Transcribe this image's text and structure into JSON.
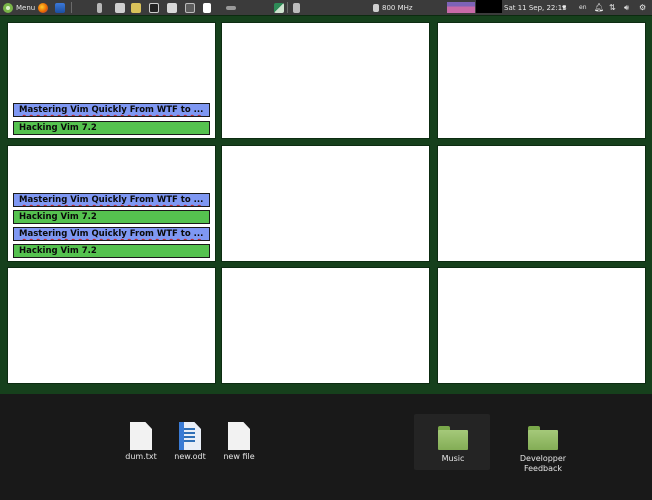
{
  "panel": {
    "menu_label": "Menu",
    "cpu_freq": "800 MHz",
    "datetime": "Sat 11 Sep, 22:13",
    "keyboard_layout": "en"
  },
  "workspaces": [
    {
      "windows": [
        {
          "title": "Mastering Vim Quickly From WTF to ...",
          "kind": "vim"
        },
        {
          "title": "Hacking Vim 7.2",
          "kind": "hack"
        }
      ]
    },
    {
      "windows": []
    },
    {
      "windows": []
    },
    {
      "windows": [
        {
          "title": "Mastering Vim Quickly From WTF to ...",
          "kind": "vim"
        },
        {
          "title": "Hacking Vim 7.2",
          "kind": "hack"
        },
        {
          "title": "Mastering Vim Quickly From WTF to ...",
          "kind": "vim"
        },
        {
          "title": "Hacking Vim 7.2",
          "kind": "hack"
        }
      ]
    },
    {
      "windows": []
    },
    {
      "windows": []
    },
    {
      "windows": []
    },
    {
      "windows": []
    },
    {
      "windows": []
    }
  ],
  "desktop": {
    "files": [
      {
        "label": "dum.txt",
        "icon": "text-file-icon"
      },
      {
        "label": "new.odt",
        "icon": "odt-document-icon"
      },
      {
        "label": "new file",
        "icon": "blank-file-icon"
      }
    ],
    "folders": [
      {
        "label": "Music",
        "icon": "folder-icon"
      },
      {
        "label": "Developper Feedback",
        "icon": "folder-icon"
      }
    ]
  },
  "colors": {
    "grid_background": "#16401c",
    "vim_window": "#7f98f3",
    "hacking_window": "#55c24f",
    "panel": "#3b3b3b"
  }
}
